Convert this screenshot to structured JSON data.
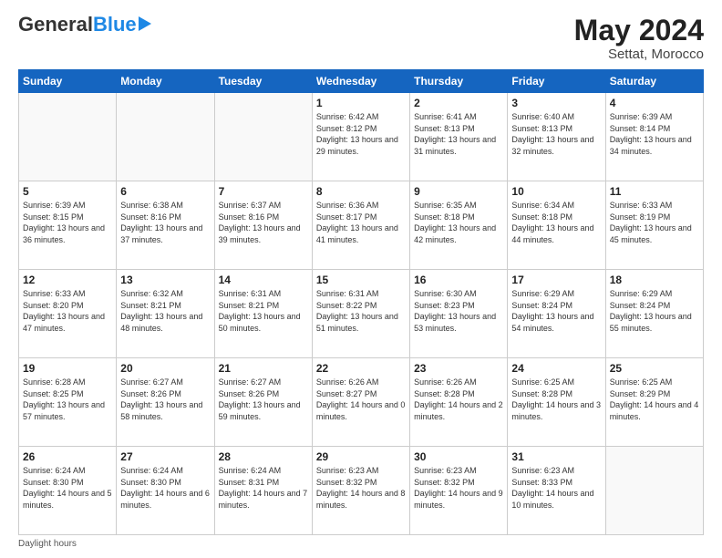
{
  "header": {
    "logo_general": "General",
    "logo_blue": "Blue",
    "month_year": "May 2024",
    "location": "Settat, Morocco"
  },
  "days_of_week": [
    "Sunday",
    "Monday",
    "Tuesday",
    "Wednesday",
    "Thursday",
    "Friday",
    "Saturday"
  ],
  "footer": {
    "daylight_label": "Daylight hours"
  },
  "weeks": [
    [
      {
        "day": "",
        "info": ""
      },
      {
        "day": "",
        "info": ""
      },
      {
        "day": "",
        "info": ""
      },
      {
        "day": "1",
        "sunrise": "6:42 AM",
        "sunset": "8:12 PM",
        "daylight": "13 hours and 29 minutes."
      },
      {
        "day": "2",
        "sunrise": "6:41 AM",
        "sunset": "8:13 PM",
        "daylight": "13 hours and 31 minutes."
      },
      {
        "day": "3",
        "sunrise": "6:40 AM",
        "sunset": "8:13 PM",
        "daylight": "13 hours and 32 minutes."
      },
      {
        "day": "4",
        "sunrise": "6:39 AM",
        "sunset": "8:14 PM",
        "daylight": "13 hours and 34 minutes."
      }
    ],
    [
      {
        "day": "5",
        "sunrise": "6:39 AM",
        "sunset": "8:15 PM",
        "daylight": "13 hours and 36 minutes."
      },
      {
        "day": "6",
        "sunrise": "6:38 AM",
        "sunset": "8:16 PM",
        "daylight": "13 hours and 37 minutes."
      },
      {
        "day": "7",
        "sunrise": "6:37 AM",
        "sunset": "8:16 PM",
        "daylight": "13 hours and 39 minutes."
      },
      {
        "day": "8",
        "sunrise": "6:36 AM",
        "sunset": "8:17 PM",
        "daylight": "13 hours and 41 minutes."
      },
      {
        "day": "9",
        "sunrise": "6:35 AM",
        "sunset": "8:18 PM",
        "daylight": "13 hours and 42 minutes."
      },
      {
        "day": "10",
        "sunrise": "6:34 AM",
        "sunset": "8:18 PM",
        "daylight": "13 hours and 44 minutes."
      },
      {
        "day": "11",
        "sunrise": "6:33 AM",
        "sunset": "8:19 PM",
        "daylight": "13 hours and 45 minutes."
      }
    ],
    [
      {
        "day": "12",
        "sunrise": "6:33 AM",
        "sunset": "8:20 PM",
        "daylight": "13 hours and 47 minutes."
      },
      {
        "day": "13",
        "sunrise": "6:32 AM",
        "sunset": "8:21 PM",
        "daylight": "13 hours and 48 minutes."
      },
      {
        "day": "14",
        "sunrise": "6:31 AM",
        "sunset": "8:21 PM",
        "daylight": "13 hours and 50 minutes."
      },
      {
        "day": "15",
        "sunrise": "6:31 AM",
        "sunset": "8:22 PM",
        "daylight": "13 hours and 51 minutes."
      },
      {
        "day": "16",
        "sunrise": "6:30 AM",
        "sunset": "8:23 PM",
        "daylight": "13 hours and 53 minutes."
      },
      {
        "day": "17",
        "sunrise": "6:29 AM",
        "sunset": "8:24 PM",
        "daylight": "13 hours and 54 minutes."
      },
      {
        "day": "18",
        "sunrise": "6:29 AM",
        "sunset": "8:24 PM",
        "daylight": "13 hours and 55 minutes."
      }
    ],
    [
      {
        "day": "19",
        "sunrise": "6:28 AM",
        "sunset": "8:25 PM",
        "daylight": "13 hours and 57 minutes."
      },
      {
        "day": "20",
        "sunrise": "6:27 AM",
        "sunset": "8:26 PM",
        "daylight": "13 hours and 58 minutes."
      },
      {
        "day": "21",
        "sunrise": "6:27 AM",
        "sunset": "8:26 PM",
        "daylight": "13 hours and 59 minutes."
      },
      {
        "day": "22",
        "sunrise": "6:26 AM",
        "sunset": "8:27 PM",
        "daylight": "14 hours and 0 minutes."
      },
      {
        "day": "23",
        "sunrise": "6:26 AM",
        "sunset": "8:28 PM",
        "daylight": "14 hours and 2 minutes."
      },
      {
        "day": "24",
        "sunrise": "6:25 AM",
        "sunset": "8:28 PM",
        "daylight": "14 hours and 3 minutes."
      },
      {
        "day": "25",
        "sunrise": "6:25 AM",
        "sunset": "8:29 PM",
        "daylight": "14 hours and 4 minutes."
      }
    ],
    [
      {
        "day": "26",
        "sunrise": "6:24 AM",
        "sunset": "8:30 PM",
        "daylight": "14 hours and 5 minutes."
      },
      {
        "day": "27",
        "sunrise": "6:24 AM",
        "sunset": "8:30 PM",
        "daylight": "14 hours and 6 minutes."
      },
      {
        "day": "28",
        "sunrise": "6:24 AM",
        "sunset": "8:31 PM",
        "daylight": "14 hours and 7 minutes."
      },
      {
        "day": "29",
        "sunrise": "6:23 AM",
        "sunset": "8:32 PM",
        "daylight": "14 hours and 8 minutes."
      },
      {
        "day": "30",
        "sunrise": "6:23 AM",
        "sunset": "8:32 PM",
        "daylight": "14 hours and 9 minutes."
      },
      {
        "day": "31",
        "sunrise": "6:23 AM",
        "sunset": "8:33 PM",
        "daylight": "14 hours and 10 minutes."
      },
      {
        "day": "",
        "info": ""
      }
    ]
  ]
}
